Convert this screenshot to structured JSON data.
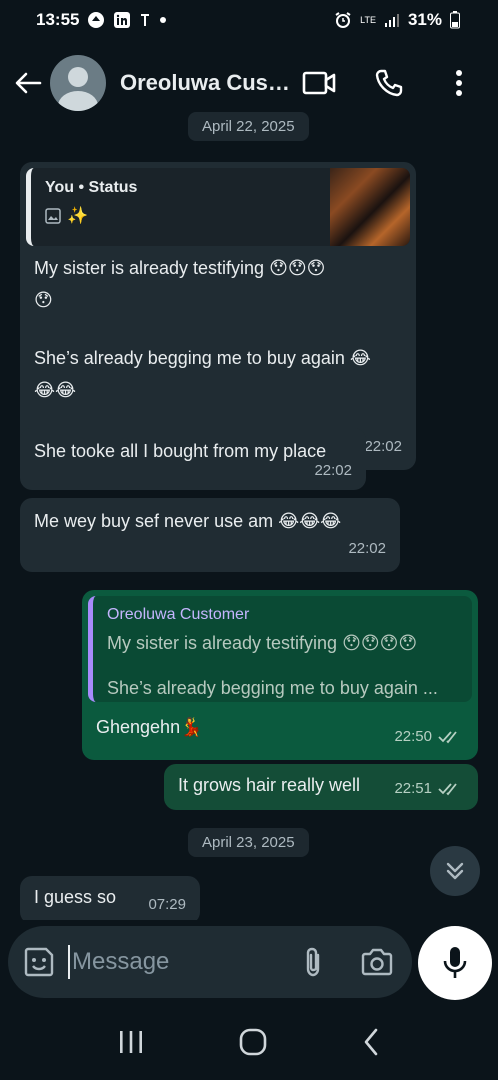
{
  "status_bar": {
    "time": "13:55",
    "battery": "31%",
    "network": "LTE"
  },
  "header": {
    "contact_name": "Oreoluwa Cust…",
    "icons": [
      "back-arrow-icon",
      "video-call-icon",
      "voice-call-icon",
      "more-options-icon"
    ]
  },
  "date_chips": {
    "top": "April 22, 2025",
    "bottom": "April 23, 2025"
  },
  "messages": {
    "m1": {
      "quote_author": "You",
      "quote_separator": "•",
      "quote_label": "Status",
      "quote_extra": "✨",
      "line1": "My sister is already testifying 😯😯😯",
      "line1b": "😯",
      "line2": "She’s already begging me to buy again 😂",
      "line2b": "😂😂",
      "time": "22:02"
    },
    "m2": {
      "text": "She tooke all I bought from my place",
      "time": "22:02"
    },
    "m3": {
      "text": "Me wey buy sef never use am 😂😂😂",
      "time": "22:02"
    },
    "m4": {
      "quote_author": "Oreoluwa Customer",
      "quote_line1": "My sister is already testifying 😯😯😯😯",
      "quote_line2": "She’s already begging me to buy again ...",
      "text": "Ghengehn💃",
      "time": "22:50"
    },
    "m5": {
      "text": "It grows hair really well",
      "time": "22:51"
    },
    "m6": {
      "text": "I guess so",
      "time": "07:29"
    }
  },
  "composer": {
    "placeholder": "Message"
  },
  "colors": {
    "background": "#0b141a",
    "incoming_bubble": "#202c33",
    "outgoing_bubble": "#0b5a3e",
    "quote_bar_out": "#a78bfa"
  }
}
